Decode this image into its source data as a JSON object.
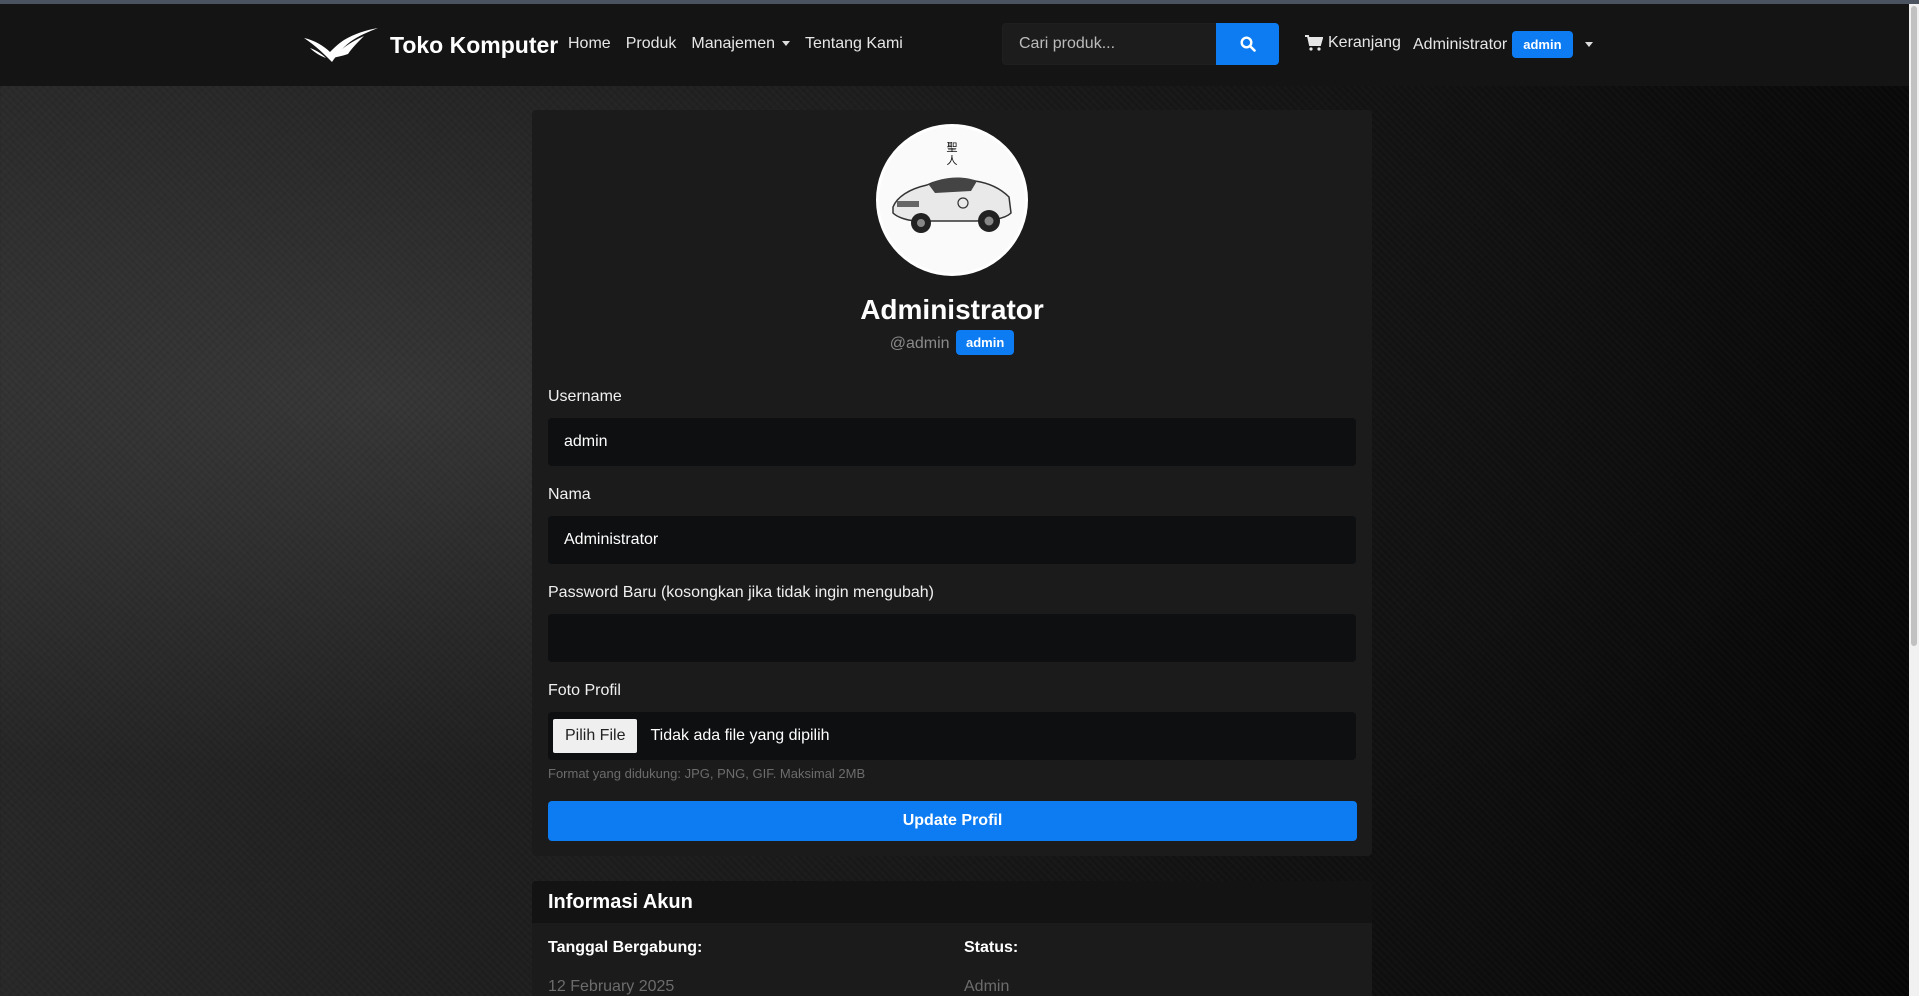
{
  "navbar": {
    "brand": "Toko Komputer",
    "links": {
      "home": "Home",
      "produk": "Produk",
      "manajemen": "Manajemen",
      "tentang": "Tentang Kami"
    },
    "search_placeholder": "Cari produk...",
    "cart_label": "Keranjang",
    "user_name": "Administrator",
    "user_role_badge": "admin"
  },
  "profile": {
    "name": "Administrator",
    "handle": "@admin",
    "role_badge": "admin",
    "avatar_caption": "聖人"
  },
  "form": {
    "username_label": "Username",
    "username_value": "admin",
    "nama_label": "Nama",
    "nama_value": "Administrator",
    "password_label": "Password Baru (kosongkan jika tidak ingin mengubah)",
    "password_value": "",
    "foto_label": "Foto Profil",
    "file_button": "Pilih File",
    "file_status": "Tidak ada file yang dipilih",
    "file_help": "Format yang didukung: JPG, PNG, GIF. Maksimal 2MB",
    "submit_label": "Update Profil"
  },
  "account_info": {
    "title": "Informasi Akun",
    "joined_label": "Tanggal Bergabung:",
    "joined_value": "12 February 2025",
    "status_label": "Status:",
    "status_value": "Admin"
  },
  "colors": {
    "accent": "#0d7cf2",
    "navbar_bg": "#141414",
    "card_bg": "#1b1b1c",
    "input_bg": "#0e0f11"
  }
}
